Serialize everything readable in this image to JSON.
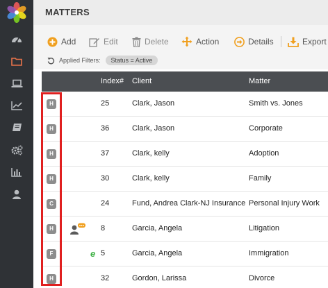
{
  "sidebar": {
    "logo": "flower-logo",
    "items": [
      {
        "id": "dashboard",
        "icon": "gauge-icon",
        "active": false
      },
      {
        "id": "matters",
        "icon": "folder-icon",
        "active": true
      },
      {
        "id": "computer",
        "icon": "laptop-icon",
        "active": false
      },
      {
        "id": "reports",
        "icon": "line-chart-icon",
        "active": false
      },
      {
        "id": "library",
        "icon": "book-icon",
        "active": false
      },
      {
        "id": "settings",
        "icon": "gears-icon",
        "active": false
      },
      {
        "id": "analytics",
        "icon": "bar-chart-icon",
        "active": false
      },
      {
        "id": "user",
        "icon": "user-icon",
        "active": false
      }
    ],
    "colors": {
      "background": "#2f3236",
      "icon": "#b9bcc0",
      "active": "#e8734a"
    }
  },
  "header": {
    "title": "MATTERS"
  },
  "toolbar": {
    "add_label": "Add",
    "edit_label": "Edit",
    "delete_label": "Delete",
    "action_label": "Action",
    "details_label": "Details",
    "export_label": "Export"
  },
  "filters": {
    "label": "Applied Filters:",
    "chip": "Status = Active"
  },
  "table": {
    "columns": {
      "index": "Index#",
      "client": "Client",
      "matter": "Matter"
    },
    "rows": [
      {
        "badge": "H",
        "extra": "",
        "index": "25",
        "client": "Clark, Jason",
        "matter": "Smith vs. Jones"
      },
      {
        "badge": "H",
        "extra": "",
        "index": "36",
        "client": "Clark, Jason",
        "matter": "Corporate"
      },
      {
        "badge": "H",
        "extra": "",
        "index": "37",
        "client": "Clark, kelly",
        "matter": "Adoption"
      },
      {
        "badge": "H",
        "extra": "",
        "index": "30",
        "client": "Clark, kelly",
        "matter": "Family"
      },
      {
        "badge": "C",
        "extra": "",
        "index": "24",
        "client": "Fund, Andrea Clark-NJ Insurance",
        "matter": "Personal Injury Work"
      },
      {
        "badge": "H",
        "extra": "user-chat-icon",
        "index": "8",
        "client": "Garcia, Angela",
        "matter": "Litigation"
      },
      {
        "badge": "F",
        "extra": "e-icon",
        "index": "5",
        "client": "Garcia, Angela",
        "matter": "Immigration"
      },
      {
        "badge": "H",
        "extra": "",
        "index": "32",
        "client": "Gordon, Larissa",
        "matter": "Divorce"
      }
    ]
  },
  "colors": {
    "accent": "#f0a020",
    "highlight": "#e02020",
    "table_header": "#4b4e52"
  }
}
